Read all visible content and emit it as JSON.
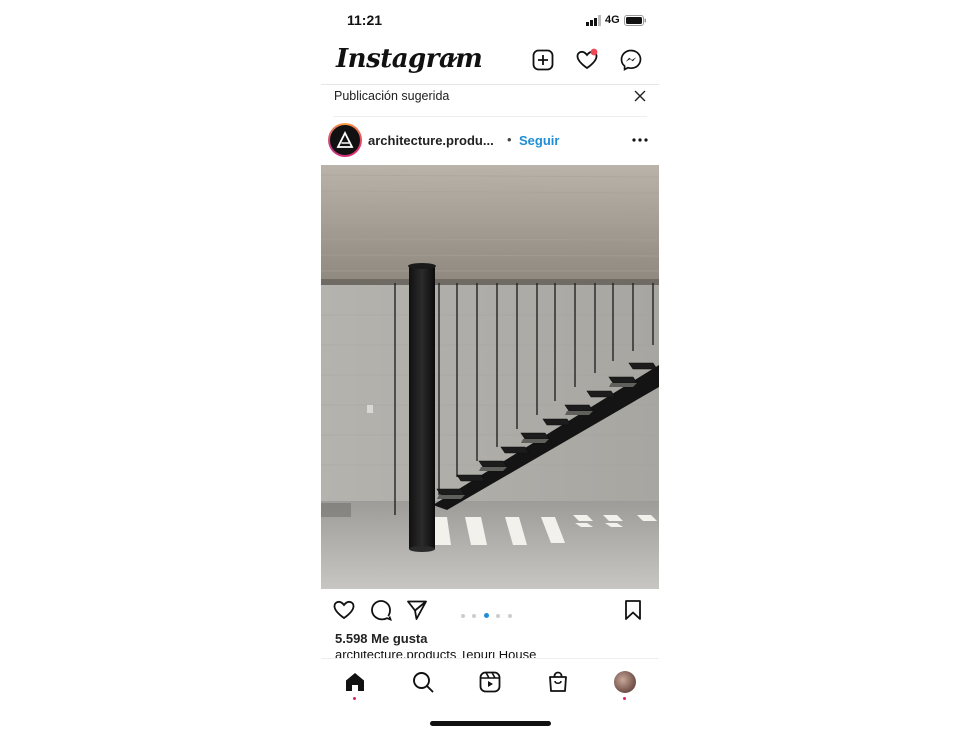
{
  "status_bar": {
    "time": "11:21",
    "network": "4G"
  },
  "header": {
    "logo_text": "Instagram",
    "icons": [
      "new-post-icon",
      "heart-icon",
      "messenger-icon"
    ],
    "notification_color": "#ed4956"
  },
  "suggestion": {
    "label": "Publicación sugerida"
  },
  "post": {
    "username": "architecture.produ...",
    "separator": "•",
    "follow_label": "Seguir",
    "carousel_total": 5,
    "carousel_active": 3,
    "likes": "5.598 Me gusta",
    "caption": "architecture.products Tepuri House"
  },
  "nav": {
    "items": [
      "home-icon",
      "search-icon",
      "reels-icon",
      "shop-icon",
      "profile-avatar"
    ]
  },
  "colors": {
    "accent": "#1f8ed6",
    "badge": "#ed4956"
  }
}
